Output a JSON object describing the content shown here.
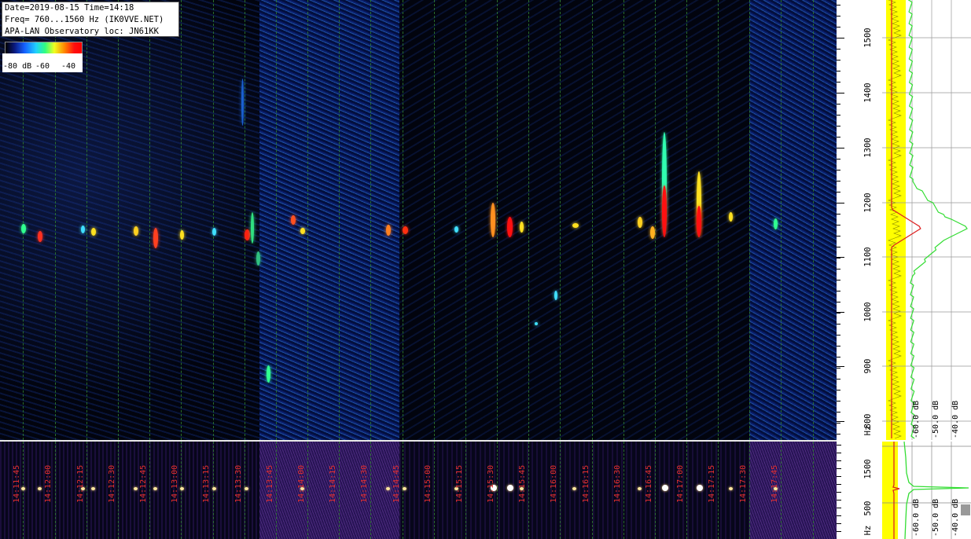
{
  "info": {
    "line1": "Date=2019-08-15 Time=14:18",
    "line2": "Freq= 760...1560 Hz (IK0VVE.NET)",
    "line3": "APA-LAN Observatory loc: JN61KK"
  },
  "colorbar": {
    "label_min": "-80 dB",
    "label_mid": "-60",
    "label_max": "-40"
  },
  "freq_axis_top": [
    "1500",
    "1400",
    "1300",
    "1200",
    "1100",
    "1000",
    "900",
    "800"
  ],
  "freq_axis_top_unit": "Hz",
  "freq_axis_bottom": [
    "1500",
    "500"
  ],
  "freq_axis_bottom_unit": "Hz",
  "spectrum_db_labels": [
    "-60.0 dB",
    "-50.0 dB",
    "-40.0 dB"
  ],
  "bottom_db_labels": [
    "-60.0 dB",
    "-50.0 dB",
    "-40.0 dB"
  ],
  "time_labels": [
    "14:11:45",
    "14:12:00",
    "14:12:15",
    "14:12:30",
    "14:12:45",
    "14:13:00",
    "14:13:15",
    "14:13:30",
    "14:13:45",
    "14:14:00",
    "14:14:15",
    "14:14:30",
    "14:14:45",
    "14:15:00",
    "14:15:15",
    "14:15:30",
    "14:15:45",
    "14:16:00",
    "14:16:15",
    "14:16:30",
    "14:16:45",
    "14:17:00",
    "14:17:15",
    "14:17:30",
    "14:17:45"
  ],
  "colors": {
    "grid": "#2f7f2f",
    "time_label": "#e63030",
    "spectrum_avg": "#ffff00",
    "spectrum_peak": "#33dd33",
    "spectrum_red": "#dd2222"
  }
}
